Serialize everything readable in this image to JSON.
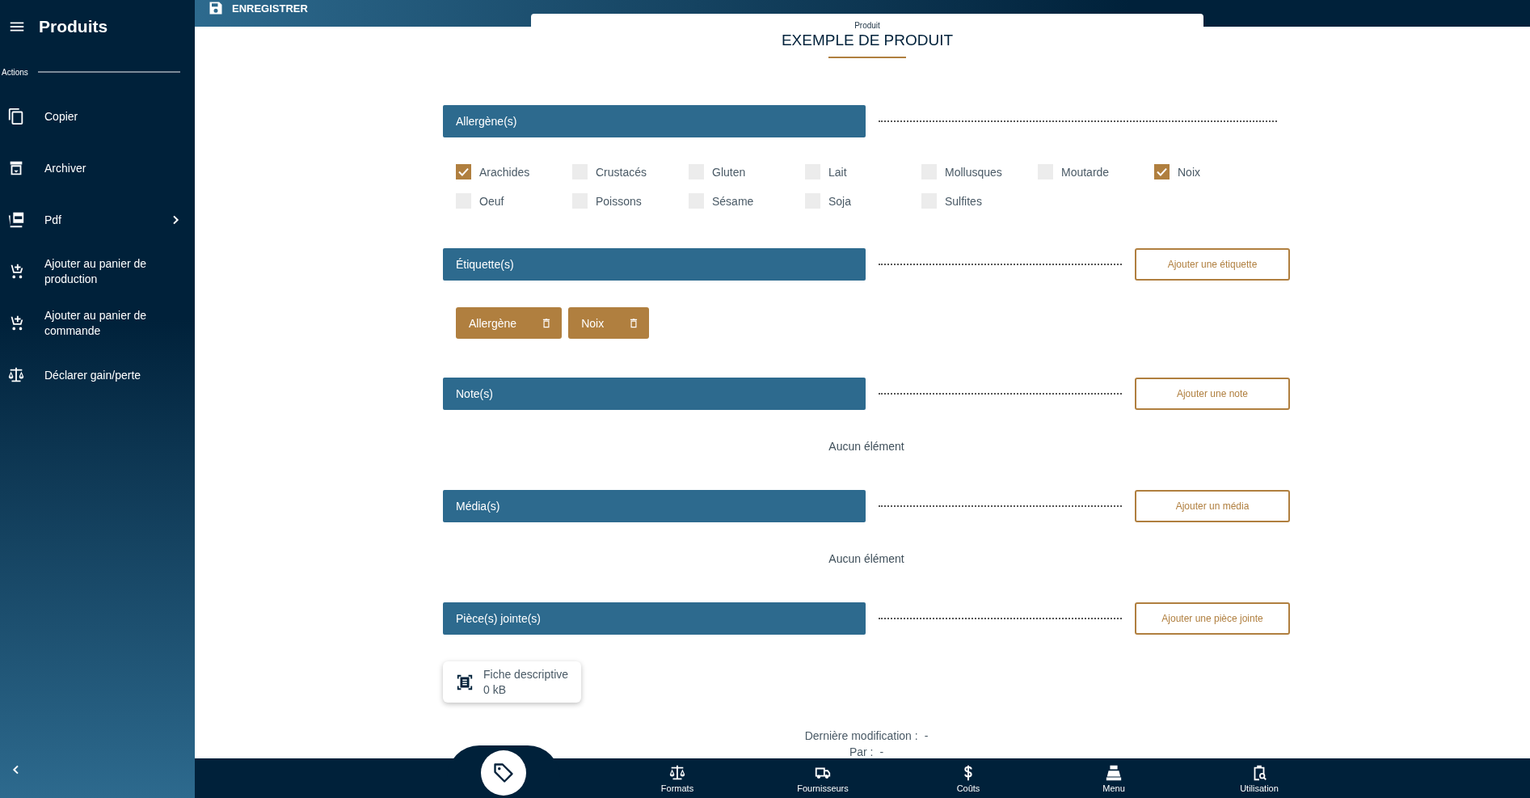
{
  "sidebar": {
    "title": "Produits",
    "section_label": "Actions",
    "items": [
      {
        "label": "Copier",
        "submenu": false
      },
      {
        "label": "Archiver",
        "submenu": false
      },
      {
        "label": "Pdf",
        "submenu": true
      },
      {
        "label": "Ajouter au panier de production",
        "submenu": false
      },
      {
        "label": "Ajouter au panier de commande",
        "submenu": false
      },
      {
        "label": "Déclarer gain/perte",
        "submenu": false
      }
    ]
  },
  "toolbar": {
    "save_label": "ENREGISTRER"
  },
  "header": {
    "subtitle": "Produit",
    "title": "EXEMPLE DE PRODUIT"
  },
  "sections": [
    {
      "kind": "checkboxes",
      "title": "Allergène(s)",
      "options": [
        {
          "label": "Arachides",
          "checked": true
        },
        {
          "label": "Crustacés",
          "checked": false
        },
        {
          "label": "Gluten",
          "checked": false
        },
        {
          "label": "Lait",
          "checked": false
        },
        {
          "label": "Mollusques",
          "checked": false
        },
        {
          "label": "Moutarde",
          "checked": false
        },
        {
          "label": "Noix",
          "checked": true
        },
        {
          "label": "Oeuf",
          "checked": false
        },
        {
          "label": "Poissons",
          "checked": false
        },
        {
          "label": "Sésame",
          "checked": false
        },
        {
          "label": "Soja",
          "checked": false
        },
        {
          "label": "Sulfites",
          "checked": false
        }
      ]
    },
    {
      "kind": "tags",
      "title": "Étiquette(s)",
      "button": "Ajouter une étiquette",
      "tags": [
        "Allergène",
        "Noix"
      ]
    },
    {
      "kind": "empty",
      "title": "Note(s)",
      "button": "Ajouter une note",
      "empty_text": "Aucun élément"
    },
    {
      "kind": "empty",
      "title": "Média(s)",
      "button": "Ajouter un média",
      "empty_text": "Aucun élément"
    },
    {
      "kind": "attachments",
      "title": "Pièce(s) jointe(s)",
      "button": "Ajouter une pièce jointe",
      "files": [
        {
          "name": "Fiche descriptive",
          "size": "0 kB"
        }
      ]
    }
  ],
  "footer": {
    "modified_label": "Dernière modification :",
    "modified_value": "-",
    "by_label": "Par :",
    "by_value": "-"
  },
  "bottom_nav": [
    {
      "selected": true
    },
    {
      "label": "Formats",
      "selected": false
    },
    {
      "label": "Fournisseurs",
      "selected": false
    },
    {
      "label": "Coûts",
      "selected": false
    },
    {
      "label": "Menu",
      "selected": false
    },
    {
      "label": "Utilisation",
      "selected": false
    }
  ]
}
